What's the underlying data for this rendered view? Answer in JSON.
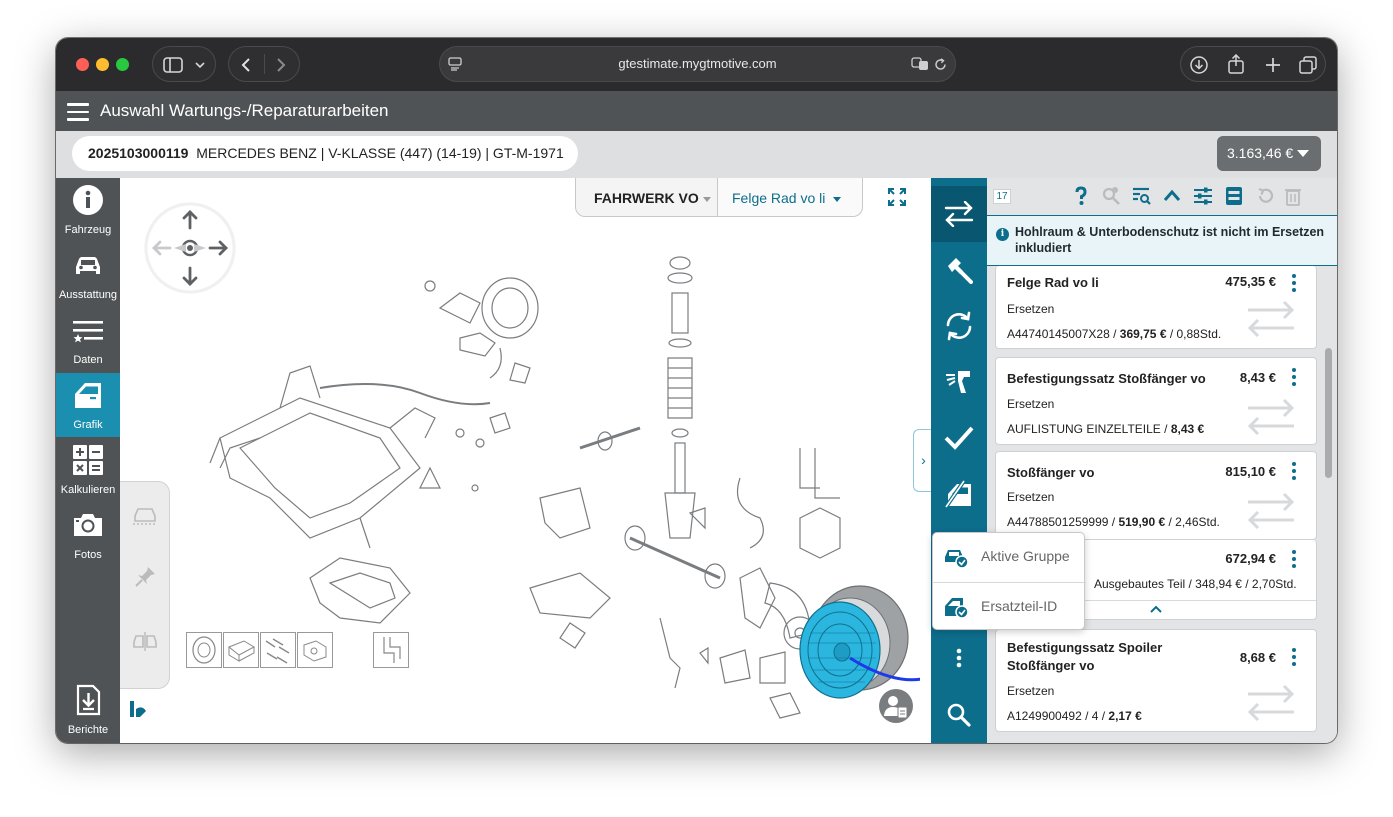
{
  "browser": {
    "url": "gtestimate.mygtmotive.com"
  },
  "app": {
    "title": "Auswahl Wartungs-/Reparaturarbeiten"
  },
  "vehicle": {
    "id": "2025103000119",
    "description": "MERCEDES BENZ | V-KLASSE (447) (14-19) | GT-M-1971",
    "total_price": "3.163,46 €"
  },
  "leftnav": {
    "items": [
      {
        "label": "Fahrzeug",
        "icon": "info-icon"
      },
      {
        "label": "Ausstattung",
        "icon": "car-icon"
      },
      {
        "label": "Daten",
        "icon": "list-star-icon"
      },
      {
        "label": "Grafik",
        "icon": "car-door-icon",
        "active": true
      },
      {
        "label": "Kalkulieren",
        "icon": "calculator-icon"
      },
      {
        "label": "Fotos",
        "icon": "camera-icon"
      },
      {
        "label": "Berichte",
        "icon": "report-download-icon"
      }
    ]
  },
  "graphic": {
    "group_select": "FAHRWERK VO",
    "part_select": "Felge Rad vo li"
  },
  "panel": {
    "count": "17",
    "notice": "Hohlraum & Unterbodenschutz ist nicht im Ersetzen inkludiert",
    "cards": [
      {
        "title": "Felge Rad vo li",
        "price": "475,35 €",
        "action": "Ersetzen",
        "detail_pre": "A44740145007X28 / ",
        "detail_bold": "369,75 €",
        "detail_post": " / 0,88Std."
      },
      {
        "title": "Befestigungssatz Stoßfänger vo",
        "price": "8,43 €",
        "action": "Ersetzen",
        "detail_pre": "AUFLISTUNG EINZELTEILE / ",
        "detail_bold": "8,43 €",
        "detail_post": ""
      },
      {
        "title": "Stoßfänger vo",
        "price": "815,10 €",
        "action": "Ersetzen",
        "detail_pre": "A44788501259999 / ",
        "detail_bold": "519,90 €",
        "detail_post": " / 2,46Std."
      },
      {
        "title": "",
        "price": "672,94 €",
        "action": "",
        "detail_pre": "Ausgebautes Teil / 348,94 € / 2,70Std.",
        "detail_bold": "",
        "detail_post": ""
      },
      {
        "title": "Befestigungssatz Spoiler Stoßfänger vo",
        "price": "8,68 €",
        "action": "Ersetzen",
        "detail_pre": "A1249900492 / 4 / ",
        "detail_bold": "2,17 €",
        "detail_post": ""
      }
    ]
  },
  "popup": {
    "items": [
      {
        "label": "Aktive Gruppe",
        "icon": "car-check-icon"
      },
      {
        "label": "Ersatzteil-ID",
        "icon": "door-check-icon"
      }
    ]
  },
  "colors": {
    "accent": "#0d6e8c",
    "active_nav": "#1a8fb0",
    "highlight_part": "#2bb6e0"
  }
}
